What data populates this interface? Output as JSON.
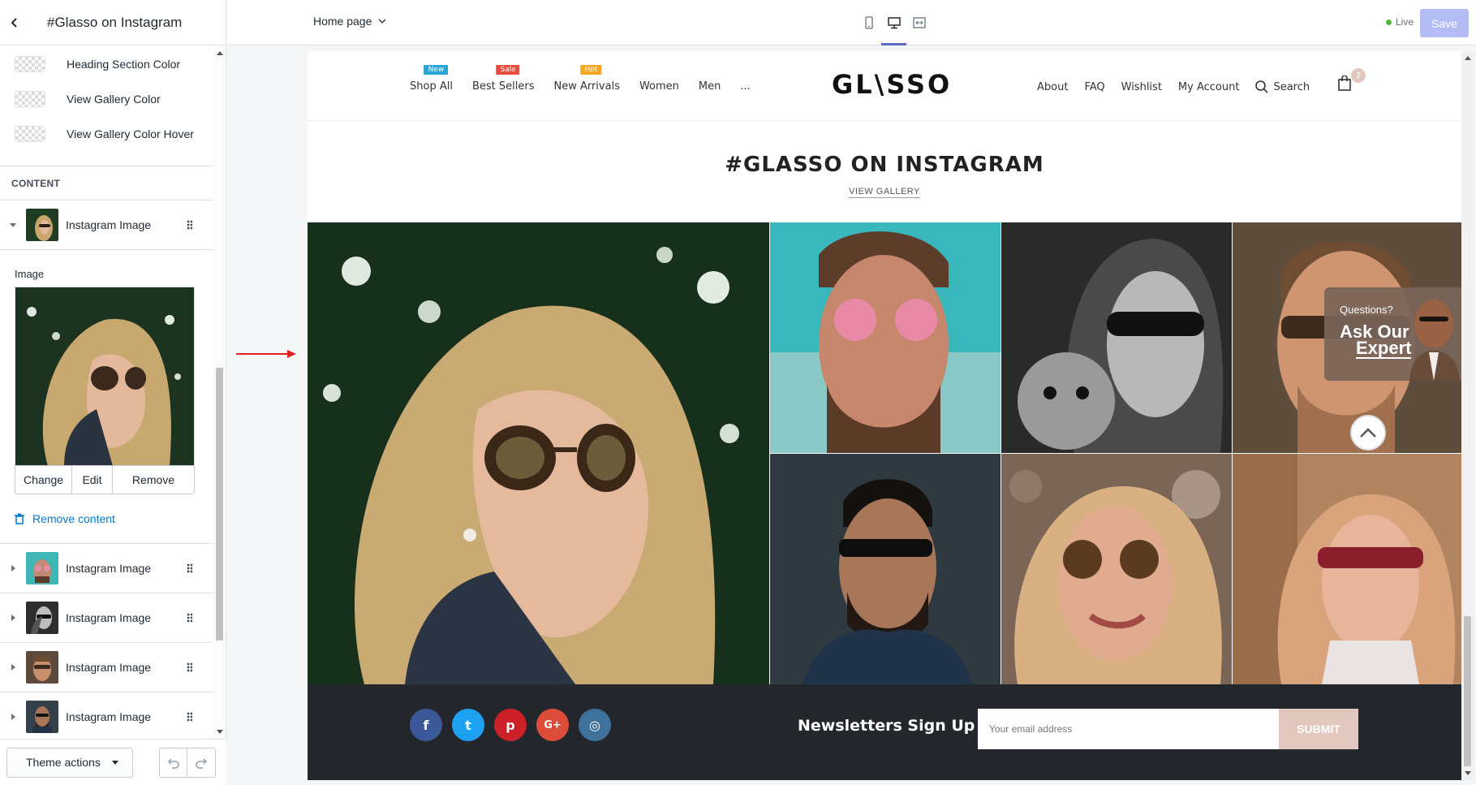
{
  "sidebar": {
    "title": "#Glasso on Instagram",
    "colors": [
      {
        "label": "Heading Section Color"
      },
      {
        "label": "View Gallery Color"
      },
      {
        "label": "View Gallery Color Hover"
      }
    ],
    "content_heading": "CONTENT",
    "expanded_block": {
      "label": "Instagram Image"
    },
    "image_setting": {
      "label": "Image",
      "actions": [
        "Change",
        "Edit",
        "Remove"
      ]
    },
    "remove_content": "Remove content",
    "blocks": [
      {
        "label": "Instagram Image"
      },
      {
        "label": "Instagram Image"
      },
      {
        "label": "Instagram Image"
      },
      {
        "label": "Instagram Image"
      }
    ],
    "footer": {
      "theme_actions": "Theme actions"
    }
  },
  "topbar": {
    "page_select": "Home page",
    "live": "Live",
    "save": "Save"
  },
  "store": {
    "nav_left": [
      {
        "label": "Shop All",
        "badge": "New",
        "badge_color": "#2aa5d8"
      },
      {
        "label": "Best Sellers",
        "badge": "Sale",
        "badge_color": "#e74c3c"
      },
      {
        "label": "New Arrivals",
        "badge": "Hot",
        "badge_color": "#f5a623"
      },
      {
        "label": "Women"
      },
      {
        "label": "Men"
      },
      {
        "label": "..."
      }
    ],
    "logo": "GL\\SSO",
    "nav_right": [
      "About",
      "FAQ",
      "Wishlist",
      "My Account"
    ],
    "search": "Search",
    "cart_count": "2",
    "insta_title": "#GLASSO ON INSTAGRAM",
    "view_gallery": "VIEW GALLERY",
    "ask_expert": {
      "question": "Questions?",
      "line1": "Ask Our",
      "line2": "Expert"
    },
    "newsletter": {
      "title": "Newsletters Sign Up",
      "placeholder": "Your email address",
      "submit": "SUBMIT"
    },
    "socials": [
      {
        "icon": "facebook-icon",
        "glyph": "f",
        "color": "#3b5998"
      },
      {
        "icon": "twitter-icon",
        "glyph": "t",
        "color": "#1da1f2"
      },
      {
        "icon": "pinterest-icon",
        "glyph": "p",
        "color": "#cb2027"
      },
      {
        "icon": "google-plus-icon",
        "glyph": "G+",
        "color": "#dd4b39"
      },
      {
        "icon": "instagram-icon",
        "glyph": "◎",
        "color": "#3f729b"
      }
    ]
  },
  "colors": {
    "accent": "#5c6ac4",
    "save_disabled": "#b3bcf5",
    "brand_pink": "#e1c7bd",
    "link": "#007ace"
  }
}
